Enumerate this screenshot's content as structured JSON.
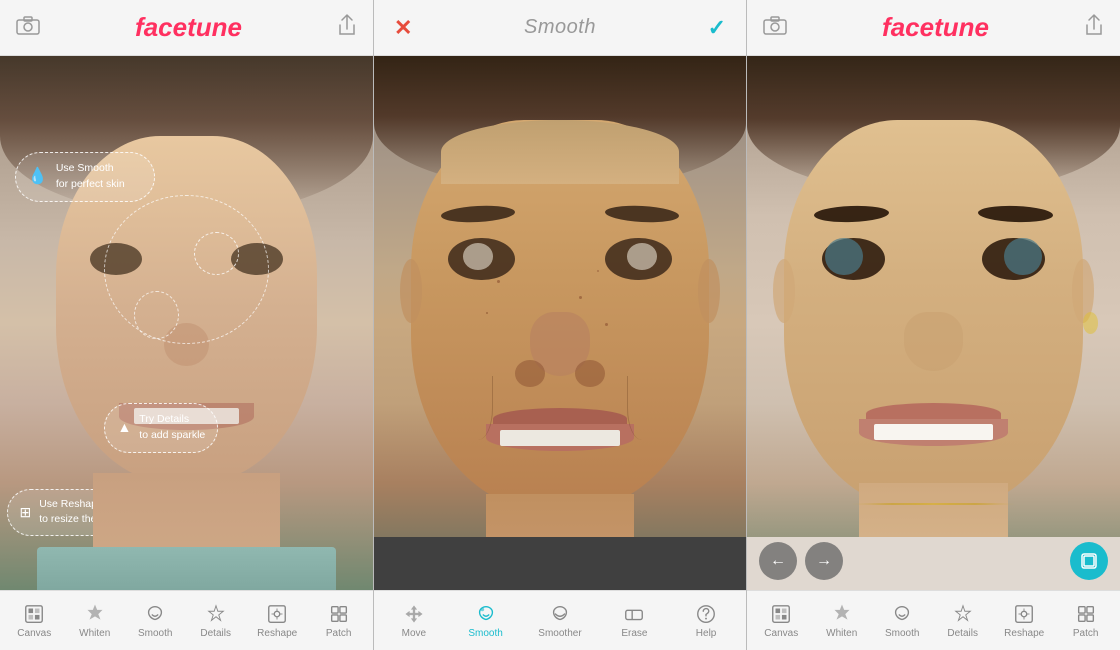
{
  "panels": {
    "left": {
      "logo": "facetune",
      "logo_face": "face",
      "logo_tune": "tune",
      "camera_icon": "📷",
      "share_icon": "⬆",
      "annotations": [
        {
          "id": "smooth-tip",
          "icon": "💧",
          "text": "Use Smooth\nfor perfect skin",
          "top": "22%",
          "left": "8%"
        },
        {
          "id": "details-tip",
          "icon": "▲",
          "text": "Try Details\nto add sparkle",
          "top": "68%",
          "left": "30%"
        },
        {
          "id": "reshape-tip",
          "icon": "⊞",
          "text": "Use Reshape\nto resize the nose",
          "top": "83%",
          "left": "4%"
        }
      ],
      "toolbar": [
        {
          "id": "canvas",
          "label": "Canvas",
          "icon": "canvas"
        },
        {
          "id": "whiten",
          "label": "Whiten",
          "icon": "whiten"
        },
        {
          "id": "smooth",
          "label": "Smooth",
          "icon": "smooth"
        },
        {
          "id": "details",
          "label": "Details",
          "icon": "details"
        },
        {
          "id": "reshape",
          "label": "Reshape",
          "icon": "reshape"
        },
        {
          "id": "patch",
          "label": "Patch",
          "icon": "patch"
        }
      ]
    },
    "middle": {
      "cancel_label": "✕",
      "title": "Smooth",
      "confirm_label": "✓",
      "toolbar": [
        {
          "id": "move",
          "label": "Move",
          "icon": "move"
        },
        {
          "id": "smooth",
          "label": "Smooth",
          "icon": "smooth",
          "active": true
        },
        {
          "id": "smoother",
          "label": "Smoother",
          "icon": "smoother"
        },
        {
          "id": "erase",
          "label": "Erase",
          "icon": "erase"
        },
        {
          "id": "help",
          "label": "Help",
          "icon": "help"
        }
      ]
    },
    "right": {
      "logo": "facetune",
      "camera_icon": "📷",
      "share_icon": "⬆",
      "nav_back": "←",
      "nav_forward": "→",
      "toolbar": [
        {
          "id": "canvas",
          "label": "Canvas",
          "icon": "canvas"
        },
        {
          "id": "whiten",
          "label": "Whiten",
          "icon": "whiten"
        },
        {
          "id": "smooth",
          "label": "Smooth",
          "icon": "smooth"
        },
        {
          "id": "details",
          "label": "Details",
          "icon": "details"
        },
        {
          "id": "reshape",
          "label": "Reshape",
          "icon": "reshape"
        },
        {
          "id": "patch",
          "label": "Patch",
          "icon": "patch"
        }
      ]
    }
  },
  "colors": {
    "accent": "#1abccd",
    "logo": "#ff3060",
    "cancel": "#e74c3c",
    "toolbar_active": "#1abccd",
    "toolbar_inactive": "#888888"
  }
}
